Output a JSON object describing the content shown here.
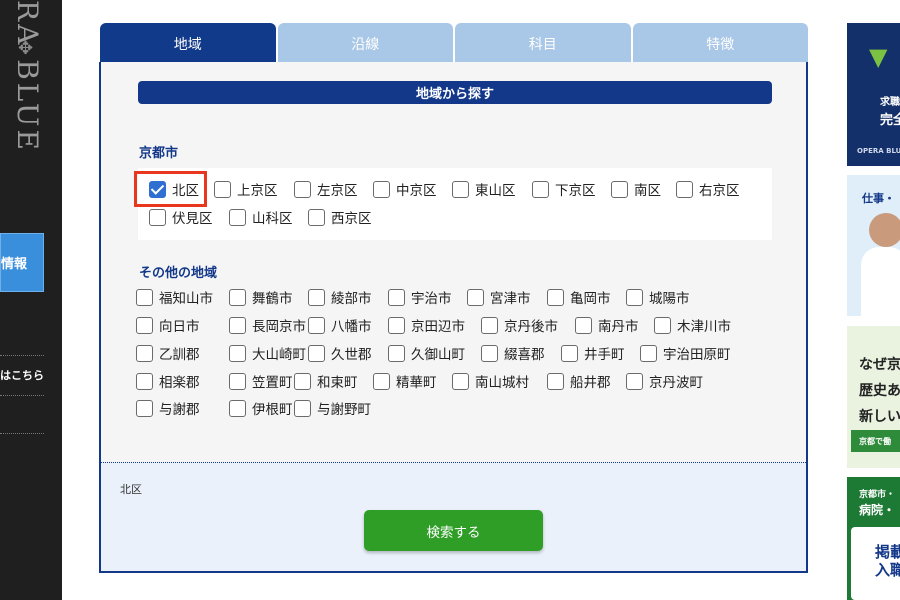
{
  "sidebar": {
    "brand": "RA BLUE",
    "job_label": "情報",
    "link_label": "はこちら"
  },
  "tabs": [
    {
      "label": "地域",
      "active": true
    },
    {
      "label": "沿線",
      "active": false
    },
    {
      "label": "科目",
      "active": false
    },
    {
      "label": "特徴",
      "active": false
    }
  ],
  "section_title": "地域から探す",
  "kyoto_city": {
    "label": "京都市",
    "items": [
      {
        "label": "北区",
        "checked": true
      },
      {
        "label": "上京区",
        "checked": false
      },
      {
        "label": "左京区",
        "checked": false
      },
      {
        "label": "中京区",
        "checked": false
      },
      {
        "label": "東山区",
        "checked": false
      },
      {
        "label": "下京区",
        "checked": false
      },
      {
        "label": "南区",
        "checked": false
      },
      {
        "label": "右京区",
        "checked": false
      },
      {
        "label": "伏見区",
        "checked": false
      },
      {
        "label": "山科区",
        "checked": false
      },
      {
        "label": "西京区",
        "checked": false
      }
    ]
  },
  "other_areas": {
    "label": "その他の地域",
    "items": [
      "福知山市",
      "舞鶴市",
      "綾部市",
      "宇治市",
      "宮津市",
      "亀岡市",
      "城陽市",
      "向日市",
      "長岡京市",
      "八幡市",
      "京田辺市",
      "京丹後市",
      "南丹市",
      "木津川市",
      "乙訓郡",
      "大山崎町",
      "久世郡",
      "久御山町",
      "綴喜郡",
      "井手町",
      "宇治田原町",
      "相楽郡",
      "笠置町",
      "和束町",
      "精華町",
      "南山城村",
      "船井郡",
      "京丹波町",
      "与謝郡",
      "伊根町",
      "与謝野町"
    ]
  },
  "selected_summary": "北区",
  "search_button": "検索する",
  "ads": {
    "ad1": {
      "line1": "求職",
      "line2": "完全",
      "brand": "OPERA BLU"
    },
    "ad2": {
      "line1": "仕事・"
    },
    "ad3": {
      "line1": "なぜ京",
      "line2": "歴史あ",
      "line3": "新しい",
      "footer": "京都で働"
    },
    "ad4": {
      "line1": "京都市・",
      "line2": "病院・",
      "line3": "掲載",
      "line4": "入職"
    }
  },
  "colors": {
    "navy": "#13388a",
    "tab_inactive": "#a9c7e6",
    "checkbox_checked": "#2f6fd1",
    "highlight": "#e8371d",
    "search_button": "#2f9e27"
  }
}
